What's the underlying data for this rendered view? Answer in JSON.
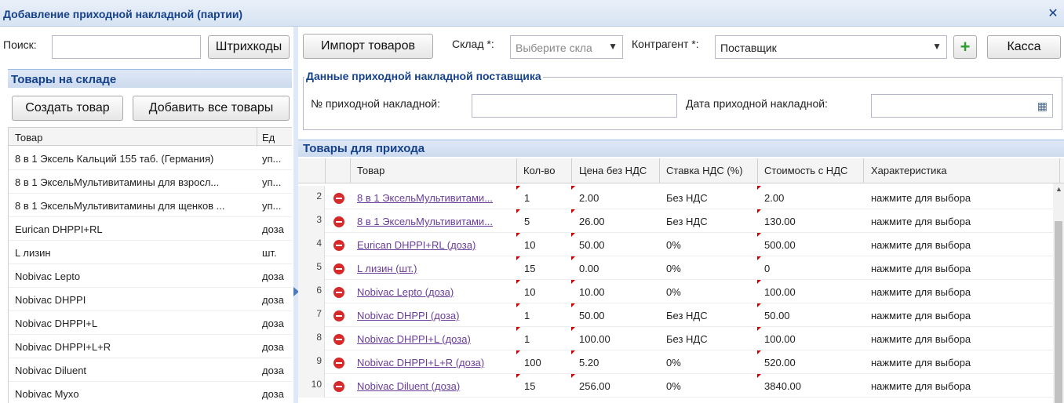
{
  "window": {
    "title": "Добавление приходной накладной (партии)"
  },
  "left": {
    "search_label": "Поиск:",
    "search_value": "",
    "barcodes_button": "Штрихкоды",
    "panel_title": "Товары на складе",
    "create_button": "Создать товар",
    "add_all_button": "Добавить все товары",
    "columns": [
      "Товар",
      "Ед"
    ],
    "rows": [
      [
        "8 в 1 Эксель Кальций 155 таб. (Германия)",
        "уп..."
      ],
      [
        "8 в 1 ЭксельМультивитамины для взросл...",
        "уп..."
      ],
      [
        "8 в 1 ЭксельМультивитамины для щенков ...",
        "уп..."
      ],
      [
        "Eurican DHPPI+RL",
        "доза"
      ],
      [
        "L лизин",
        "шт."
      ],
      [
        "Nobivac Lepto",
        "доза"
      ],
      [
        "Nobivac DHPPI",
        "доза"
      ],
      [
        "Nobivac DHPPI+L",
        "доза"
      ],
      [
        "Nobivac DHPPI+L+R",
        "доза"
      ],
      [
        "Nobivac Diluent",
        "доза"
      ],
      [
        "Nobivac Myxo",
        "доза"
      ]
    ]
  },
  "toolbar": {
    "import_button": "Импорт товаров",
    "warehouse_label": "Склад *:",
    "warehouse_placeholder": "Выберите скла",
    "counterparty_label": "Контрагент *:",
    "counterparty_value": "Поставщик",
    "cash_button": "Касса"
  },
  "supplier": {
    "legend": "Данные приходной накладной поставщика",
    "invoice_no_label": "№ приходной накладной:",
    "invoice_no_value": "",
    "invoice_date_label": "Дата приходной накладной:",
    "invoice_date_value": ""
  },
  "incoming": {
    "title": "Товары для прихода",
    "columns": [
      "Товар",
      "Кол-во",
      "Цена без НДС",
      "Ставка НДС (%)",
      "Стоимость с НДС",
      "Характеристика"
    ],
    "rows": [
      {
        "n": "2",
        "product": "8 в 1 ЭксельМультивитами...",
        "qty": "1",
        "price": "2.00",
        "vat": "Без НДС",
        "cost": "2.00",
        "feature": "нажмите для выбора"
      },
      {
        "n": "3",
        "product": "8 в 1 ЭксельМультивитами...",
        "qty": "5",
        "price": "26.00",
        "vat": "Без НДС",
        "cost": "130.00",
        "feature": "нажмите для выбора"
      },
      {
        "n": "4",
        "product": "Eurican DHPPI+RL (доза)",
        "qty": "10",
        "price": "50.00",
        "vat": "0%",
        "cost": "500.00",
        "feature": "нажмите для выбора"
      },
      {
        "n": "5",
        "product": "L лизин (шт.)",
        "qty": "15",
        "price": "0.00",
        "vat": "0%",
        "cost": "0",
        "feature": "нажмите для выбора"
      },
      {
        "n": "6",
        "product": "Nobivac Lepto (доза)",
        "qty": "10",
        "price": "10.00",
        "vat": "0%",
        "cost": "100.00",
        "feature": "нажмите для выбора"
      },
      {
        "n": "7",
        "product": "Nobivac DHPPI (доза)",
        "qty": "1",
        "price": "50.00",
        "vat": "Без НДС",
        "cost": "50.00",
        "feature": "нажмите для выбора"
      },
      {
        "n": "8",
        "product": "Nobivac DHPPI+L (доза)",
        "qty": "1",
        "price": "100.00",
        "vat": "Без НДС",
        "cost": "100.00",
        "feature": "нажмите для выбора"
      },
      {
        "n": "9",
        "product": "Nobivac DHPPI+L+R (доза)",
        "qty": "100",
        "price": "5.20",
        "vat": "0%",
        "cost": "520.00",
        "feature": "нажмите для выбора"
      },
      {
        "n": "10",
        "product": "Nobivac Diluent (доза)",
        "qty": "15",
        "price": "256.00",
        "vat": "0%",
        "cost": "3840.00",
        "feature": "нажмите для выбора"
      }
    ]
  },
  "colors": {
    "title_text": "#15428b",
    "delete_icon": "#d62a2a",
    "link": "#6a3d9a",
    "add_icon": "#2e9e2e"
  }
}
